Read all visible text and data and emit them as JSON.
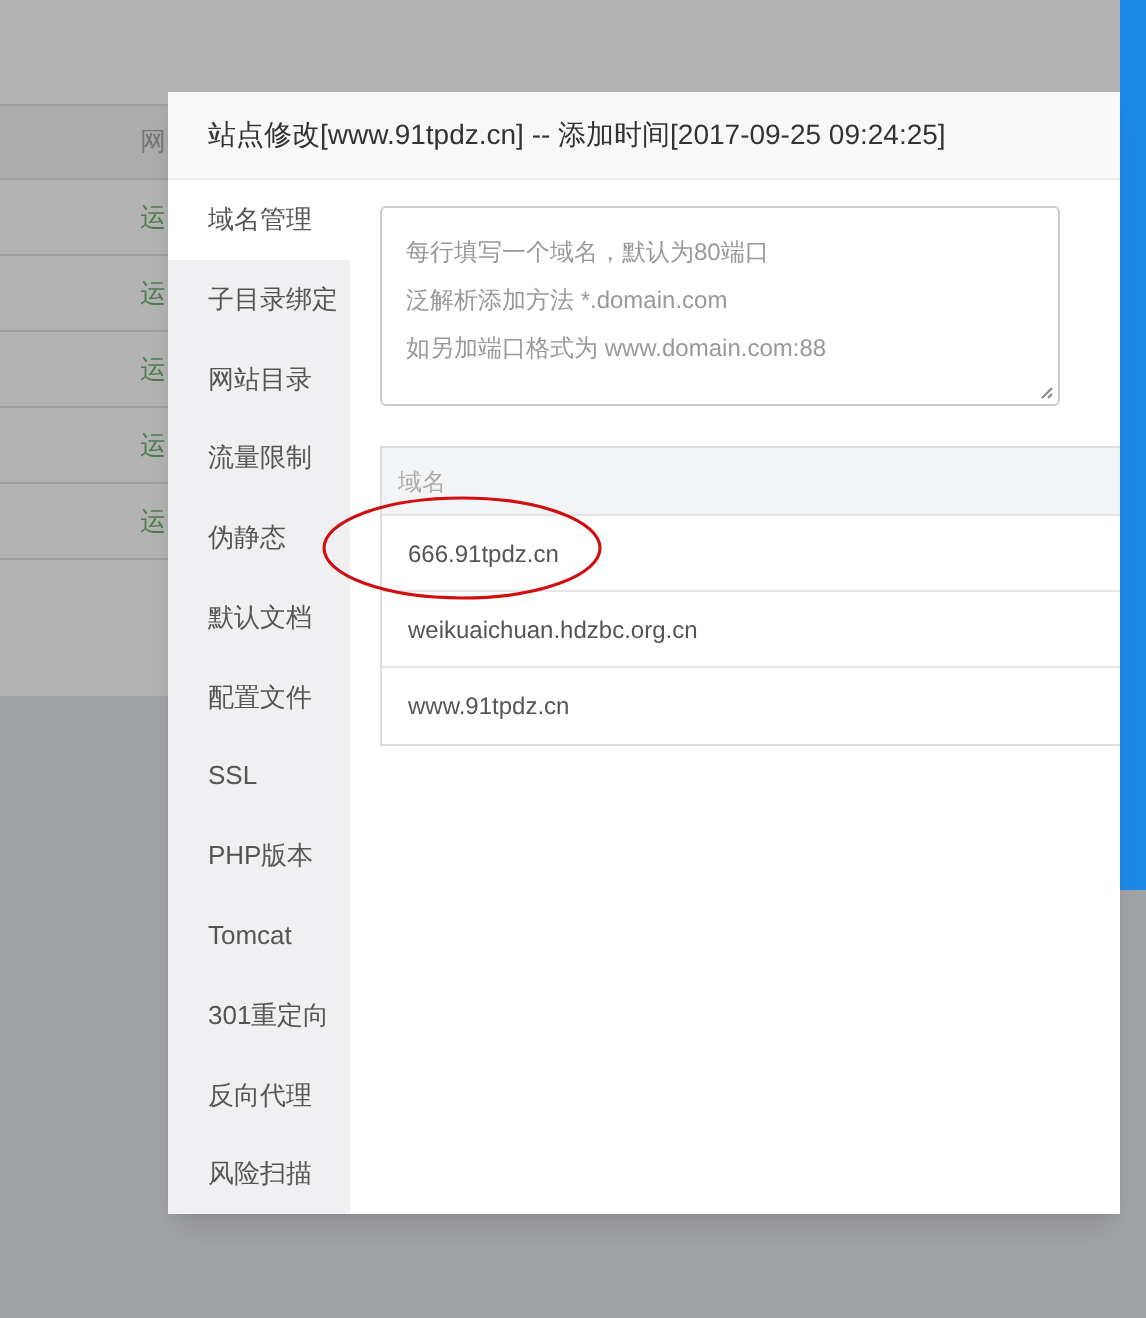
{
  "background_table": {
    "header": "网",
    "rows": [
      "运",
      "运",
      "运",
      "运",
      "运"
    ]
  },
  "dialog": {
    "title": "站点修改[www.91tpdz.cn] -- 添加时间[2017-09-25 09:24:25]",
    "sidebar": [
      {
        "label": "域名管理",
        "selected": true
      },
      {
        "label": "子目录绑定",
        "selected": false
      },
      {
        "label": "网站目录",
        "selected": false
      },
      {
        "label": "流量限制",
        "selected": false
      },
      {
        "label": "伪静态",
        "selected": false
      },
      {
        "label": "默认文档",
        "selected": false
      },
      {
        "label": "配置文件",
        "selected": false
      },
      {
        "label": "SSL",
        "selected": false
      },
      {
        "label": "PHP版本",
        "selected": false
      },
      {
        "label": "Tomcat",
        "selected": false
      },
      {
        "label": "301重定向",
        "selected": false
      },
      {
        "label": "反向代理",
        "selected": false
      },
      {
        "label": "风险扫描",
        "selected": false
      }
    ],
    "domain_input": {
      "hint_lines": [
        "每行填写一个域名，默认为80端口",
        "泛解析添加方法 *.domain.com",
        "如另加端口格式为 www.domain.com:88"
      ]
    },
    "domain_table": {
      "columns": [
        "域名"
      ],
      "rows": [
        "666.91tpdz.cn",
        "weikuaichuan.hdzbc.org.cn",
        "www.91tpdz.cn"
      ]
    }
  }
}
